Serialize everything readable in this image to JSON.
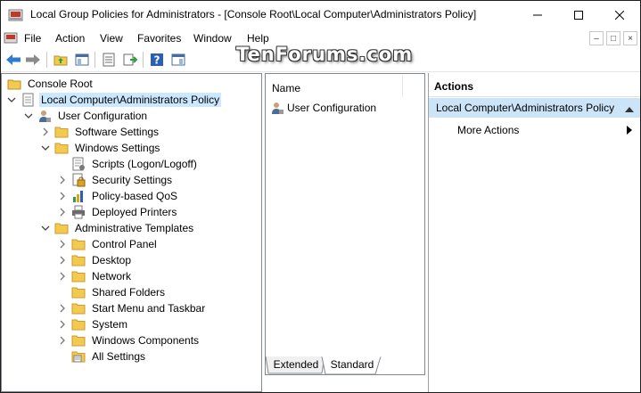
{
  "window": {
    "title": "Local Group Policies for Administrators - [Console Root\\Local Computer\\Administrators Policy]",
    "controls": {
      "minimize": "minimize-icon",
      "maximize": "maximize-icon",
      "close": "close-icon"
    }
  },
  "menu": {
    "items": [
      "File",
      "Action",
      "View",
      "Favorites",
      "Window",
      "Help"
    ],
    "mdi_controls": [
      "–",
      "□",
      "×"
    ]
  },
  "watermark": "TenForums.com",
  "toolbar": {
    "icons": [
      "back-arrow-icon",
      "forward-arrow-icon",
      "up-folder-icon",
      "show-hide-tree-icon",
      "properties-icon",
      "export-list-icon",
      "help-icon",
      "show-hide-action-pane-icon"
    ]
  },
  "tree": {
    "items": [
      {
        "label": "Console Root",
        "level": 0,
        "expander": "none",
        "icon": "console-root-icon"
      },
      {
        "label": "Local Computer\\Administrators Policy",
        "level": 0,
        "expander": "expanded",
        "icon": "policy-document-icon",
        "selected": true
      },
      {
        "label": "User Configuration",
        "level": 1,
        "expander": "expanded",
        "icon": "user-config-icon"
      },
      {
        "label": "Software Settings",
        "level": 2,
        "expander": "collapsed",
        "icon": "folder-icon"
      },
      {
        "label": "Windows Settings",
        "level": 2,
        "expander": "expanded",
        "icon": "folder-icon"
      },
      {
        "label": "Scripts (Logon/Logoff)",
        "level": 3,
        "expander": "none",
        "icon": "scripts-icon"
      },
      {
        "label": "Security Settings",
        "level": 3,
        "expander": "collapsed",
        "icon": "security-settings-icon"
      },
      {
        "label": "Policy-based QoS",
        "level": 3,
        "expander": "collapsed",
        "icon": "qos-chart-icon"
      },
      {
        "label": "Deployed Printers",
        "level": 3,
        "expander": "collapsed",
        "icon": "printer-icon"
      },
      {
        "label": "Administrative Templates",
        "level": 2,
        "expander": "expanded",
        "icon": "folder-icon"
      },
      {
        "label": "Control Panel",
        "level": 3,
        "expander": "collapsed",
        "icon": "folder-icon"
      },
      {
        "label": "Desktop",
        "level": 3,
        "expander": "collapsed",
        "icon": "folder-icon"
      },
      {
        "label": "Network",
        "level": 3,
        "expander": "collapsed",
        "icon": "folder-icon"
      },
      {
        "label": "Shared Folders",
        "level": 3,
        "expander": "none",
        "icon": "folder-icon"
      },
      {
        "label": "Start Menu and Taskbar",
        "level": 3,
        "expander": "collapsed",
        "icon": "folder-icon"
      },
      {
        "label": "System",
        "level": 3,
        "expander": "collapsed",
        "icon": "folder-icon"
      },
      {
        "label": "Windows Components",
        "level": 3,
        "expander": "collapsed",
        "icon": "folder-icon"
      },
      {
        "label": "All Settings",
        "level": 3,
        "expander": "none",
        "icon": "all-settings-icon"
      }
    ]
  },
  "center": {
    "column_header": "Name",
    "items": [
      {
        "label": "User Configuration",
        "icon": "user-config-icon"
      }
    ],
    "tabs": [
      "Extended",
      "Standard"
    ],
    "active_tab": "Standard"
  },
  "actions": {
    "header": "Actions",
    "section": "Local Computer\\Administrators Policy",
    "items": [
      "More Actions"
    ]
  },
  "colors": {
    "selection": "#cce8ff",
    "action_section": "#cce4f7",
    "folder": "#f3c94f",
    "pane_border": "#828790"
  }
}
